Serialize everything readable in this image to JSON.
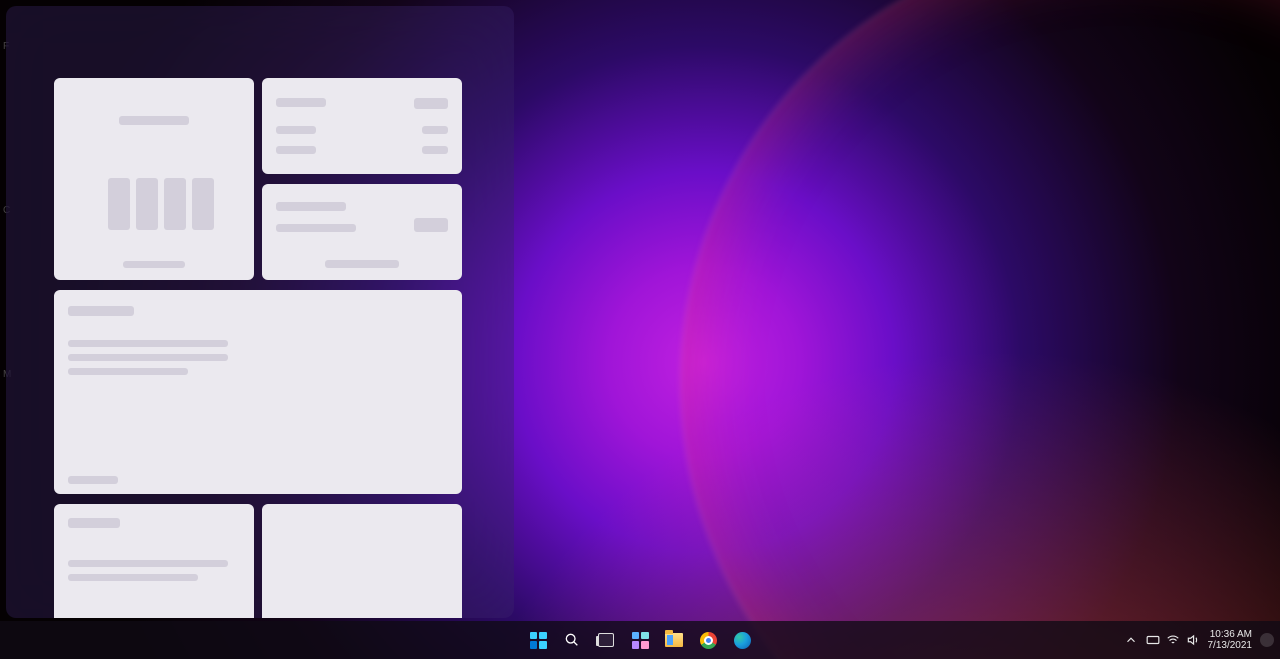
{
  "clock": {
    "time": "10:36 AM",
    "date": "7/13/2021"
  }
}
